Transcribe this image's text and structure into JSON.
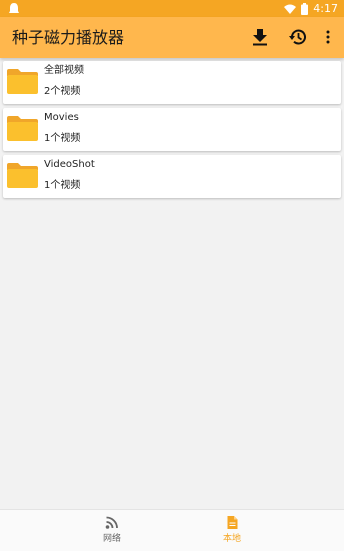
{
  "status_bar": {
    "time": "4:17",
    "icons": [
      "notification-icon",
      "wifi-icon",
      "battery-icon"
    ]
  },
  "app_bar": {
    "title": "种子磁力播放器",
    "actions": [
      "download-icon",
      "history-icon",
      "more-vert-icon"
    ]
  },
  "folders": [
    {
      "name": "全部视频",
      "count": "2个视频"
    },
    {
      "name": "Movies",
      "count": "1个视频"
    },
    {
      "name": "VideoShot",
      "count": "1个视频"
    }
  ],
  "bottom_nav": {
    "items": [
      {
        "label": "网络",
        "icon": "rss-icon",
        "active": false
      },
      {
        "label": "本地",
        "icon": "file-icon",
        "active": true
      }
    ]
  },
  "colors": {
    "status_bar": "#f5a623",
    "app_bar": "#ffb74d",
    "folder": "#fbc02d",
    "active_tab": "#f5a623",
    "inactive_tab": "#666666"
  }
}
